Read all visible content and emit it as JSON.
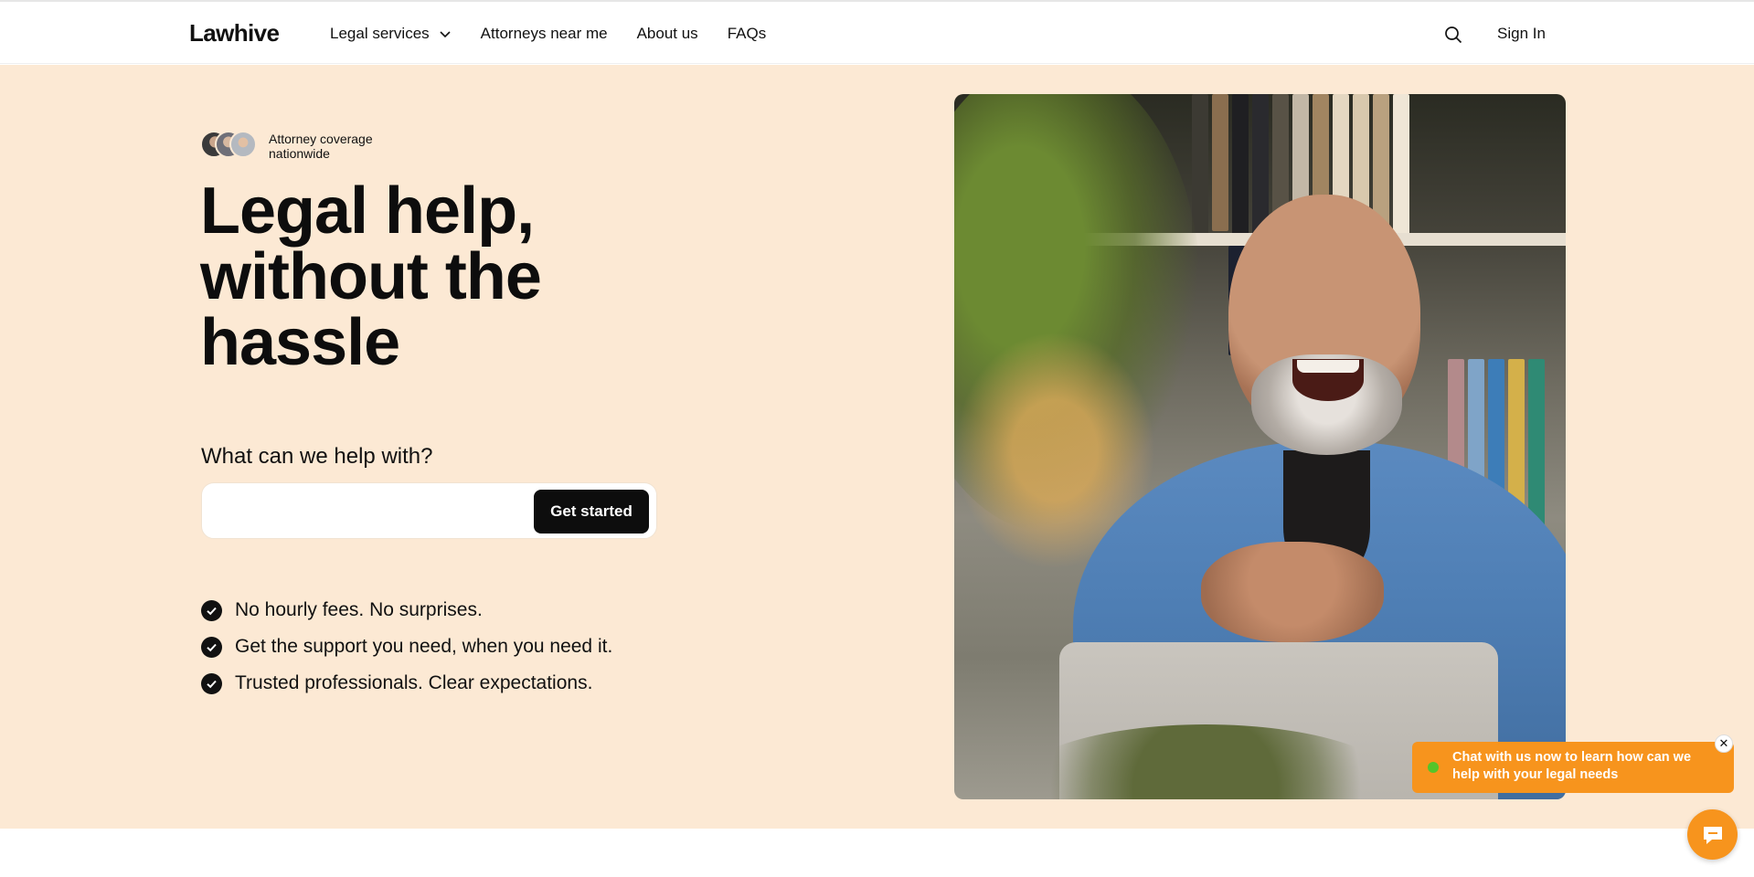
{
  "header": {
    "logo": "Lawhive",
    "nav": [
      {
        "label": "Legal services",
        "has_dropdown": true
      },
      {
        "label": "Attorneys near me"
      },
      {
        "label": "About us"
      },
      {
        "label": "FAQs"
      }
    ],
    "search_icon": "search-icon",
    "sign_in": "Sign In"
  },
  "hero": {
    "coverage_line1": "Attorney coverage",
    "coverage_line2": "nationwide",
    "headline_line1": "Legal help,",
    "headline_line2": "without the",
    "headline_line3": "hassle",
    "question": "What can we help with?",
    "input_value": "",
    "cta": "Get started",
    "benefits": [
      "No hourly fees. No surprises.",
      "Get the support you need, when you need it.",
      "Trusted professionals. Clear expectations."
    ]
  },
  "chat": {
    "message": "Chat with us now to learn how can we help with your legal needs",
    "close_glyph": "✕",
    "icon": "chat-icon"
  },
  "colors": {
    "hero_bg": "#fce9d4",
    "cta_bg": "#0d0d0d",
    "chat_orange": "#f7941d",
    "online_green": "#55c42a"
  }
}
